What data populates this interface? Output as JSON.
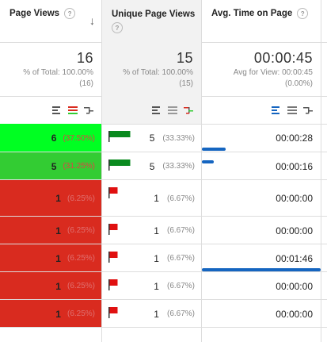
{
  "headers": {
    "page_views": "Page Views",
    "unique_page_views": "Unique Page Views",
    "avg_time": "Avg. Time on Page",
    "help_glyph": "?",
    "sort_glyph": "↓"
  },
  "totals": {
    "page_views": {
      "value": "16",
      "line1": "% of Total: 100.00%",
      "line2": "(16)"
    },
    "unique_page_views": {
      "value": "15",
      "line1": "% of Total: 100.00%",
      "line2": "(15)"
    },
    "avg_time": {
      "value": "00:00:45",
      "line1": "Avg for View: 00:00:45",
      "line2": "(0.00%)"
    }
  },
  "colors": {
    "bright_green": "#00ff22",
    "mid_green": "#33cc33",
    "red": "#d92b1f",
    "flag_green": "#0a8a1f",
    "flag_red": "#e01010",
    "bar_blue": "#1565c0"
  },
  "rows": [
    {
      "pv": "6",
      "pv_pct": "(37.50%)",
      "upv": "5",
      "upv_pct": "(33.33%)",
      "avg": "00:00:28"
    },
    {
      "pv": "5",
      "pv_pct": "(31.25%)",
      "upv": "5",
      "upv_pct": "(33.33%)",
      "avg": "00:00:16"
    },
    {
      "pv": "1",
      "pv_pct": "(6.25%)",
      "upv": "1",
      "upv_pct": "(6.67%)",
      "avg": "00:00:00"
    },
    {
      "pv": "1",
      "pv_pct": "(6.25%)",
      "upv": "1",
      "upv_pct": "(6.67%)",
      "avg": "00:00:00"
    },
    {
      "pv": "1",
      "pv_pct": "(6.25%)",
      "upv": "1",
      "upv_pct": "(6.67%)",
      "avg": "00:01:46"
    },
    {
      "pv": "1",
      "pv_pct": "(6.25%)",
      "upv": "1",
      "upv_pct": "(6.67%)",
      "avg": "00:00:00"
    },
    {
      "pv": "1",
      "pv_pct": "(6.25%)",
      "upv": "1",
      "upv_pct": "(6.67%)",
      "avg": "00:00:00"
    }
  ]
}
